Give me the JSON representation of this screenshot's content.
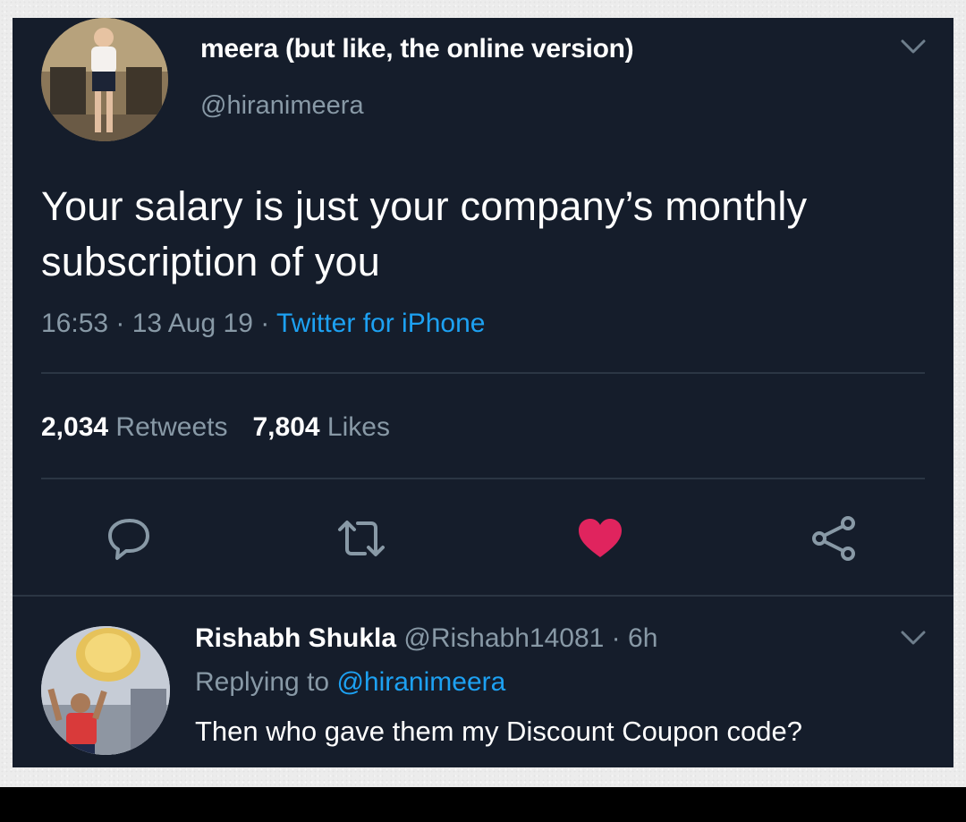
{
  "tweet": {
    "author_name": "meera (but like, the online version)",
    "author_handle": "@hiranimeera",
    "text": "Your salary is just your company’s monthly subscription of you",
    "time": "16:53",
    "date": "13 Aug 19",
    "separator": " · ",
    "source": "Twitter for iPhone",
    "retweet_count": "2,034",
    "retweet_label": "Retweets",
    "like_count": "7,804",
    "like_label": "Likes",
    "liked": true
  },
  "actions": {
    "reply_icon": "reply-icon",
    "retweet_icon": "retweet-icon",
    "like_icon": "heart-icon",
    "share_icon": "share-icon"
  },
  "reply": {
    "author_name": "Rishabh Shukla",
    "author_handle": "@Rishabh14081",
    "separator": " · ",
    "age": "6h",
    "replying_prefix": "Replying to ",
    "replying_to": "@hiranimeera",
    "text": "Then who gave them my Discount Coupon code?"
  },
  "colors": {
    "background": "#151d2b",
    "accent": "#1da1f2",
    "like": "#e0245e",
    "muted": "#8899a6"
  }
}
